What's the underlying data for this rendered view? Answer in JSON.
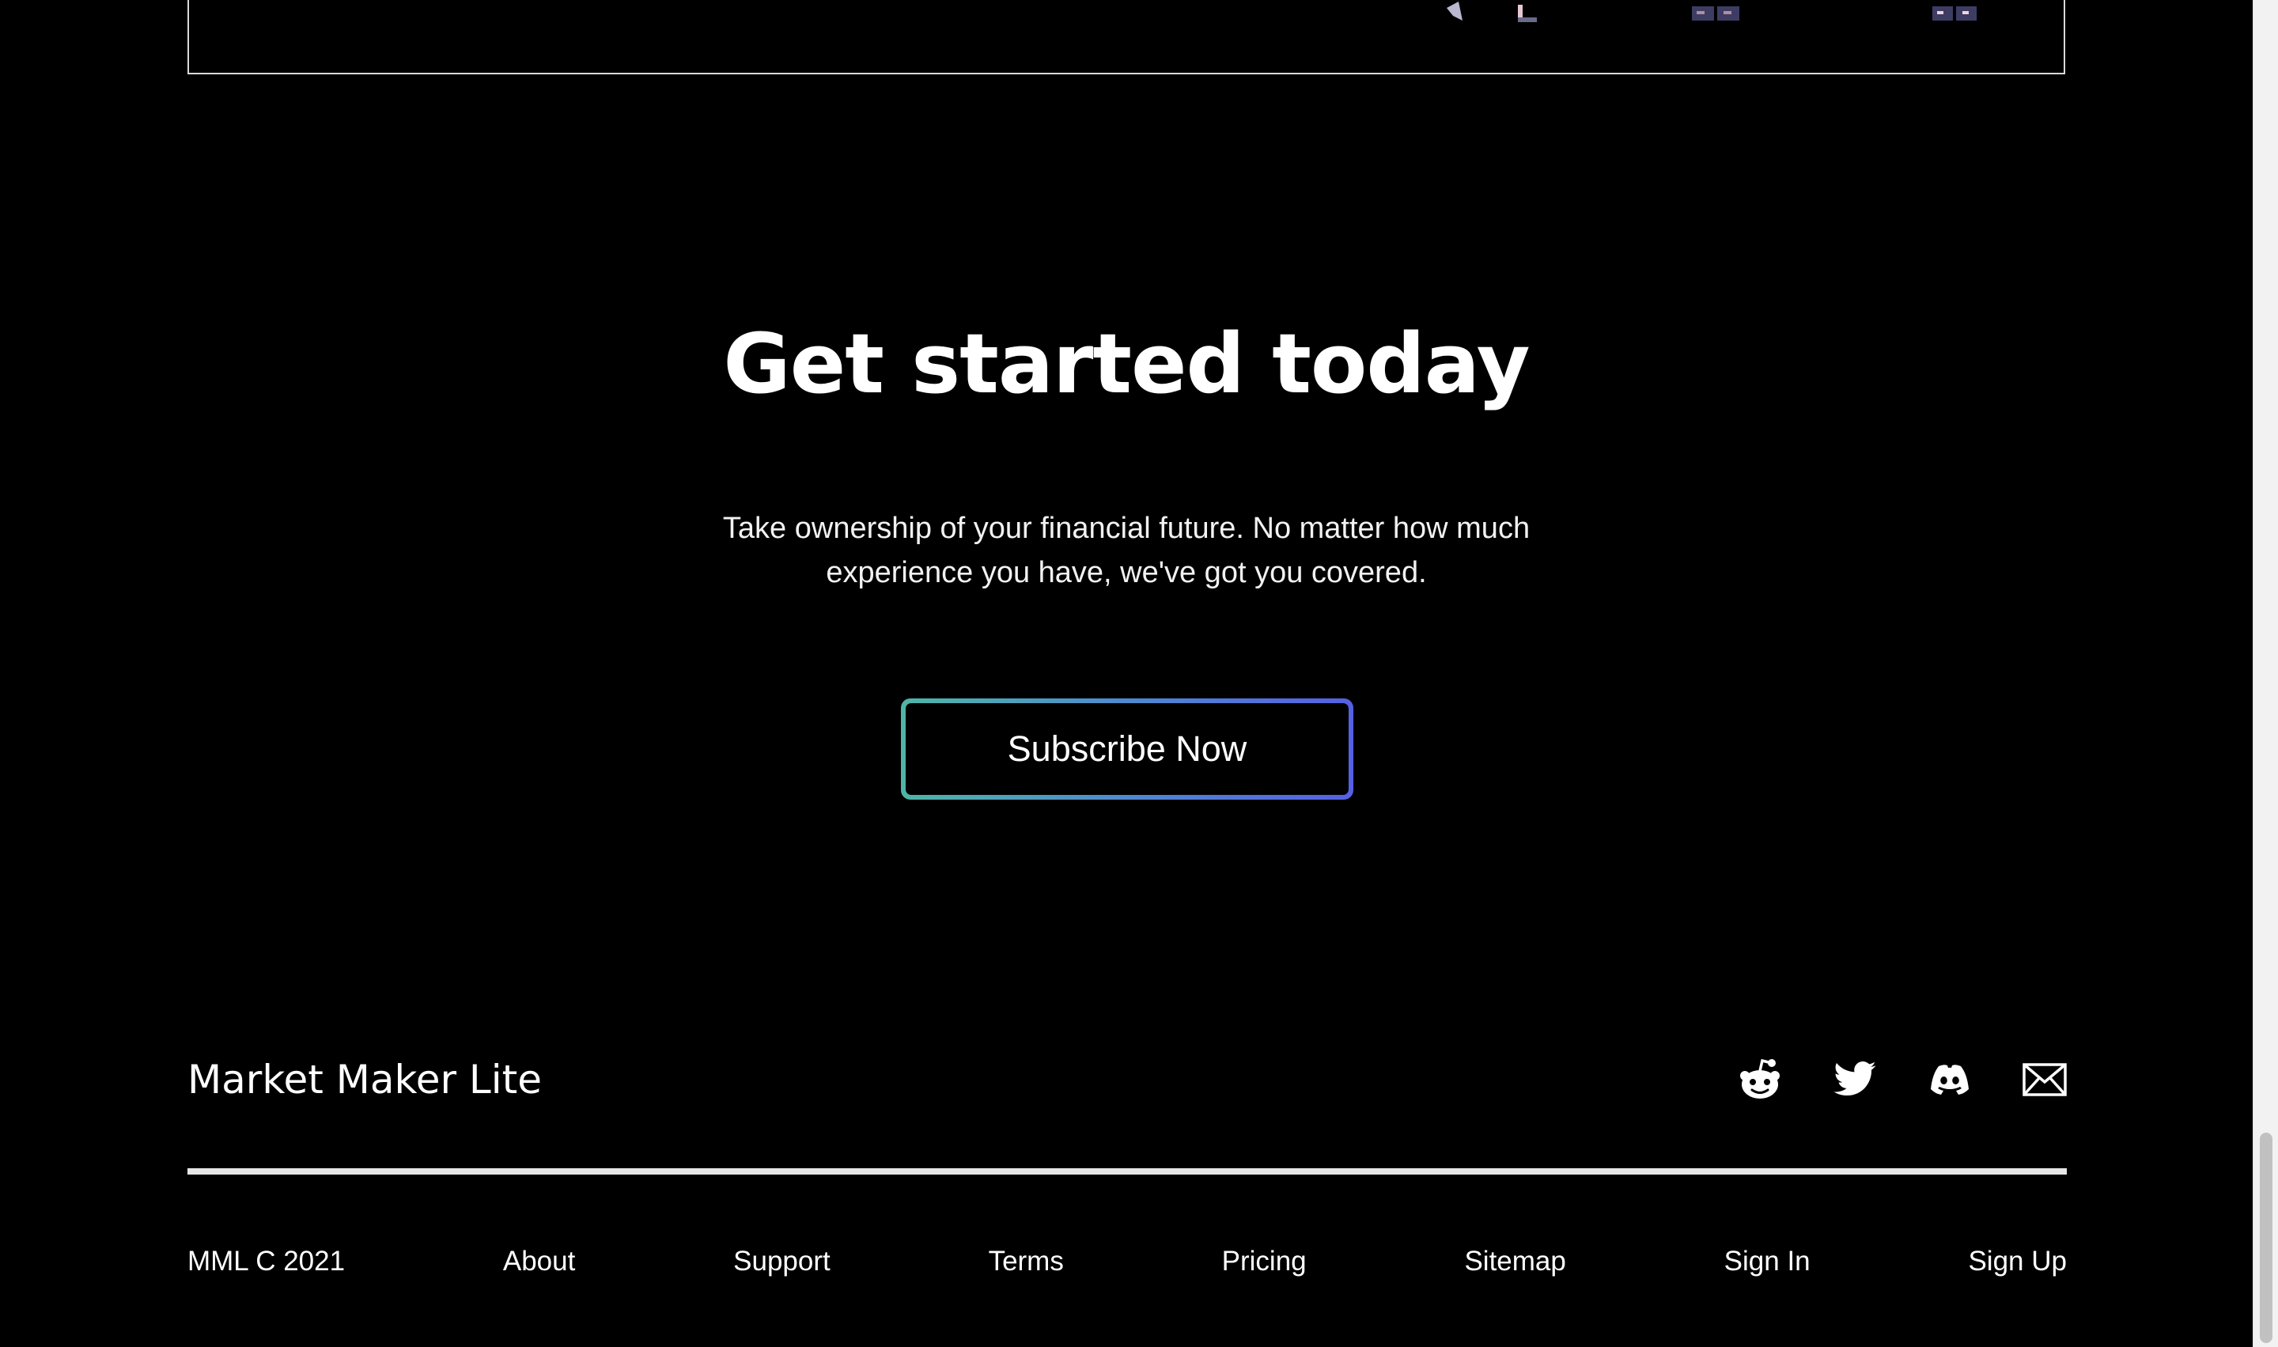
{
  "cta": {
    "title": "Get started today",
    "description": "Take ownership of your financial future. No matter how much experience you have, we've got you covered.",
    "button_label": "Subscribe Now"
  },
  "footer": {
    "brand": "Market Maker Lite",
    "social": [
      "reddit-icon",
      "twitter-icon",
      "discord-icon",
      "mail-icon"
    ],
    "copyright": "MML C 2021",
    "links": [
      "About",
      "Support",
      "Terms",
      "Pricing",
      "Sitemap",
      "Sign In",
      "Sign Up"
    ]
  },
  "colors": {
    "background": "#000000",
    "text": "#ffffff",
    "button_gradient_start": "#4fb5a7",
    "button_gradient_end": "#5560e3",
    "divider": "#e6e6e6"
  }
}
